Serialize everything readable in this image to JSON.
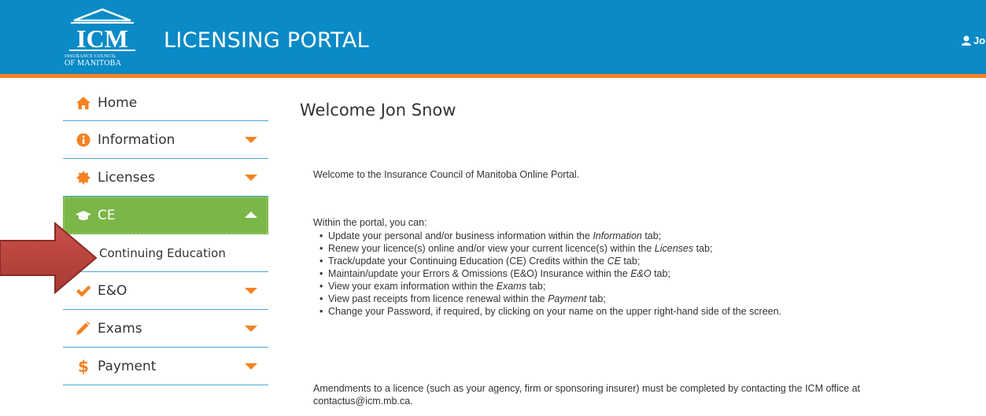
{
  "header": {
    "logo_text": "ICM",
    "logo_line1": "INSURANCE COUNCIL",
    "logo_line2": "OF MANITOBA",
    "title": "LICENSING PORTAL",
    "user_label": "Jo"
  },
  "colors": {
    "header_bg": "#0a8ac6",
    "accent": "#f58220",
    "active_bg": "#7ab648",
    "arrow": "#c0392b"
  },
  "sidebar": {
    "items": [
      {
        "label": "Home",
        "icon": "home-icon"
      },
      {
        "label": "Information",
        "icon": "info-icon"
      },
      {
        "label": "Licenses",
        "icon": "badge-icon"
      },
      {
        "label": "CE",
        "icon": "graduation-cap-icon"
      },
      {
        "label": "E&O",
        "icon": "checkmark-icon"
      },
      {
        "label": "Exams",
        "icon": "pencil-icon"
      },
      {
        "label": "Payment",
        "icon": "dollar-icon"
      }
    ],
    "ce_subitem": "Continuing Education"
  },
  "main": {
    "title": "Welcome Jon Snow",
    "intro": "Welcome to the Insurance Council of Manitoba Online Portal.",
    "within": "Within the portal, you can:",
    "bullets": [
      {
        "pre": "Update your personal and/or business information within the ",
        "em": "Information",
        "post": " tab;"
      },
      {
        "pre": "Renew your licence(s) online and/or view your current licence(s) within the ",
        "em": "Licenses",
        "post": " tab;"
      },
      {
        "pre": "Track/update your Continuing Education (CE) Credits within the ",
        "em": "CE",
        "post": " tab;"
      },
      {
        "pre": "Maintain/update your Errors & Omissions (E&O) Insurance within the ",
        "em": "E&O",
        "post": " tab;"
      },
      {
        "pre": "View your exam information within the ",
        "em": "Exams",
        "post": " tab;"
      },
      {
        "pre": "View past receipts from licence renewal within the ",
        "em": "Payment",
        "post": " tab;"
      },
      {
        "pre": "Change your Password, if required, by clicking on your name on the upper right-hand side of the screen.",
        "em": "",
        "post": ""
      }
    ],
    "amendments": "Amendments to a licence (such as your agency, firm or sponsoring insurer) must be completed by contacting the ICM office at contactus@icm.mb.ca."
  }
}
